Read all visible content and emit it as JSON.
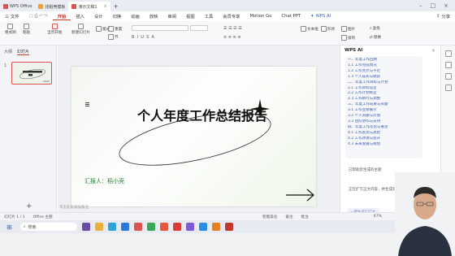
{
  "titlebar": {
    "tabs": [
      {
        "label": "WPS Office",
        "color": "#d9534f",
        "active": false
      },
      {
        "label": "找稻壳模板",
        "color": "#e8a33d",
        "active": false
      },
      {
        "label": "演示文稿1",
        "color": "#d9534f",
        "active": true
      }
    ],
    "new_tab": "+"
  },
  "menubar": {
    "file": "三 文件",
    "items": [
      "开始",
      "插入",
      "设计",
      "切换",
      "动画",
      "放映",
      "审阅",
      "视图",
      "工具",
      "会员专享",
      "Motion Go",
      "Chat PPT"
    ],
    "active": "开始",
    "wps_ai": "WPS AI",
    "share": "分享"
  },
  "ribbon": {
    "format_painter": "格式刷",
    "paste": "粘贴",
    "from_start": "当页开始",
    "new_slide": "新建幻灯片",
    "layout": "版式",
    "section": "节",
    "reset": "重置",
    "textbox": "文本框",
    "shape": "形状",
    "image": "图片",
    "arrange": "排列",
    "find": "查找",
    "replace": "替换",
    "select": "选择"
  },
  "left_panel": {
    "tabs": [
      "大纲",
      "幻灯片"
    ],
    "active_tab": "幻灯片",
    "slide_number": "1",
    "add_button": "+"
  },
  "slide": {
    "title": "个人年度工作总结报告",
    "reporter": "汇报人：稻小壳",
    "notes_placeholder": "单击此处添加备注"
  },
  "ai_panel": {
    "header": "WPS AI",
    "outline": [
      "一、年度工作回顾",
      "1.1 工作完成情况",
      "1.2 工作亮点与不足",
      "1.3 个人成长与收获",
      "二、年度工作目标与计划",
      "2.1 工作目标设定",
      "2.2 工作计划制定",
      "2.3 工作执行与调整",
      "三、年度工作成果与贡献",
      "3.1 工作业绩展示",
      "3.2 个人贡献与价值",
      "3.3 团队协作与支持",
      "四、年度工作反思与展望",
      "4.1 工作反思与总结",
      "4.2 工作改进与提升",
      "4.3 未来发展与规划"
    ],
    "status_1": "已帮助您生成的主题",
    "status_2": "正在扩写正文内容，并生成幻灯片 (1/19)",
    "status_3": "一键生成幻灯片",
    "input_placeholder": ""
  },
  "statusbar": {
    "slide_info": "幻灯片 1 / 1",
    "theme": "Office 主题",
    "smart_beautify": "智能美化",
    "notes": "备注",
    "comments": "批注",
    "zoom": "67%"
  },
  "taskbar": {
    "search_label": "搜索"
  },
  "colors": {
    "accent": "#c0392b",
    "ai_blue": "#3b5dab"
  }
}
